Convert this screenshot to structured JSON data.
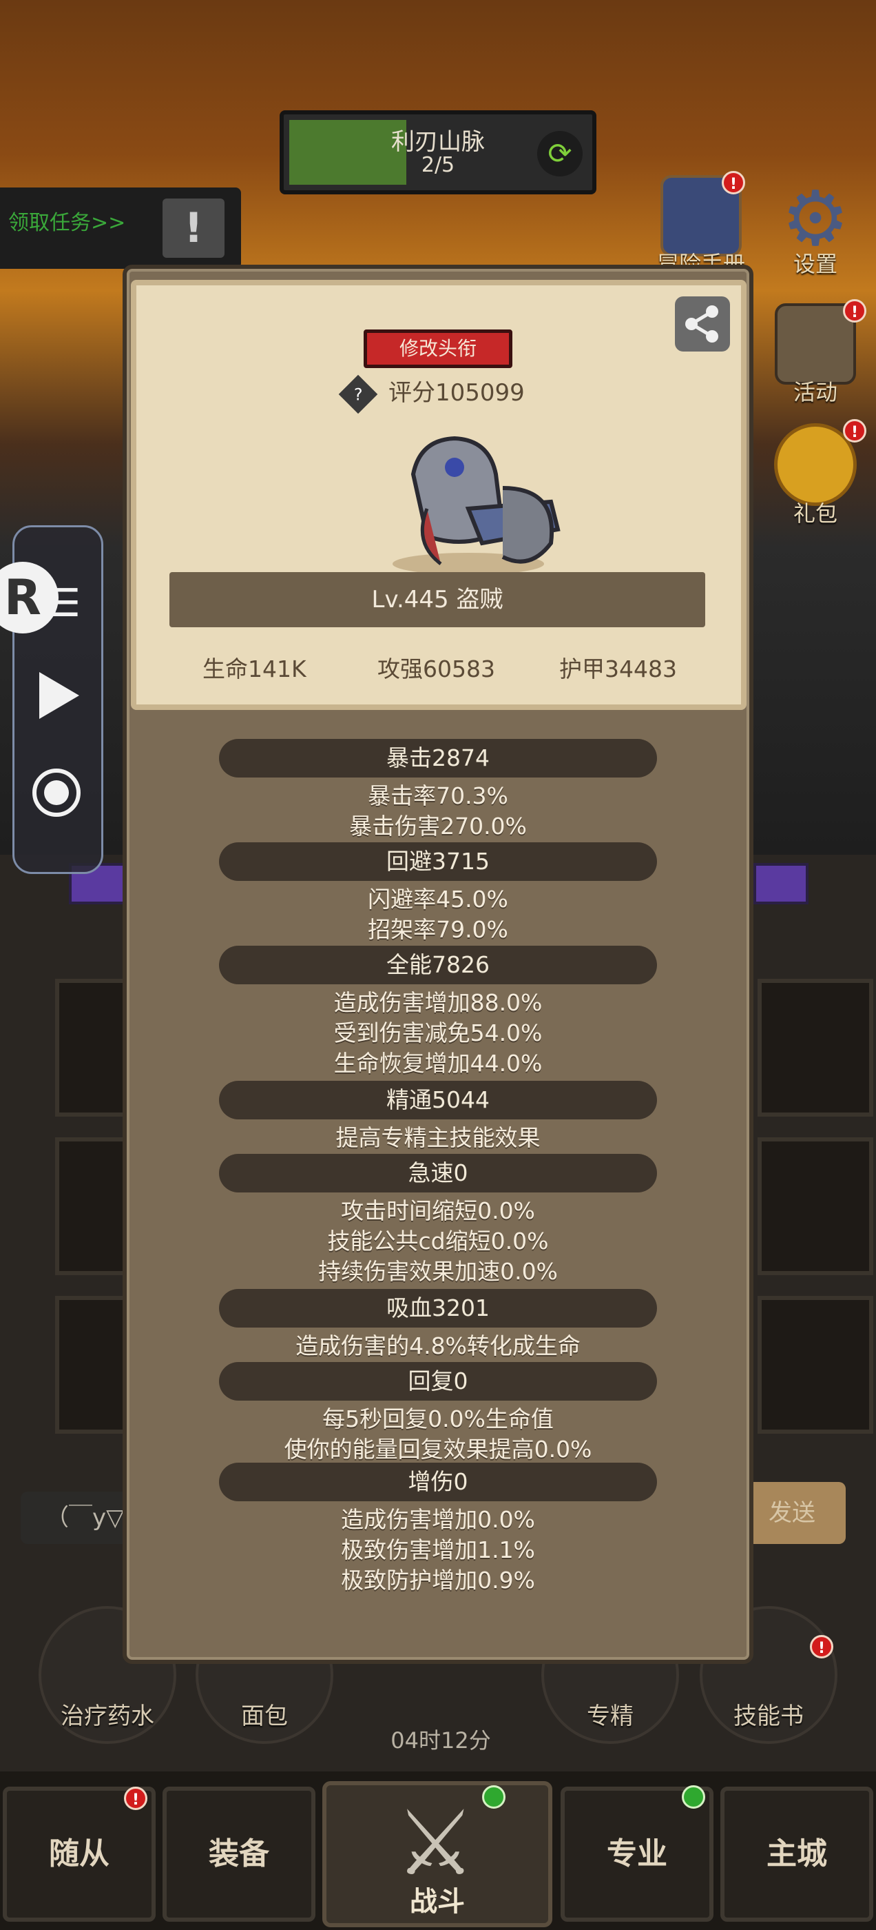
{
  "zone": {
    "name": "利刃山脉",
    "progress": "2/5",
    "progress_fraction": 0.35
  },
  "quest": {
    "label": "领取任务>>",
    "badge": "!"
  },
  "side_menu": [
    {
      "label": "冒险手册"
    },
    {
      "label": "设置"
    },
    {
      "label": "活动"
    },
    {
      "label": "礼包"
    }
  ],
  "badge_mark": "!",
  "chat": {
    "input_text": "（￣y▽",
    "send_label": "发送"
  },
  "consumables": [
    {
      "label": "治疗药水"
    },
    {
      "label": "面包"
    },
    {
      "label": "专精"
    },
    {
      "label": "技能书"
    }
  ],
  "timer": "04时12分",
  "nav": {
    "companion": "随从",
    "equipment": "装备",
    "battle": "战斗",
    "profession": "专业",
    "city": "主城"
  },
  "profile": {
    "change_title": "修改头衔",
    "score_icon": "?",
    "score": "评分105099",
    "level_class": "Lv.445 盗贼",
    "hp": "生命141K",
    "attack": "攻强60583",
    "armor": "护甲34483"
  },
  "sections": [
    {
      "header": "暴击2874",
      "lines": [
        "暴击率70.3%",
        "暴击伤害270.0%"
      ]
    },
    {
      "header": "回避3715",
      "lines": [
        "闪避率45.0%",
        "招架率79.0%"
      ]
    },
    {
      "header": "全能7826",
      "lines": [
        "造成伤害增加88.0%",
        "受到伤害减免54.0%",
        "生命恢复增加44.0%"
      ]
    },
    {
      "header": "精通5044",
      "lines": [
        "提高专精主技能效果"
      ]
    },
    {
      "header": "急速0",
      "lines": [
        "攻击时间缩短0.0%",
        "技能公共cd缩短0.0%",
        "持续伤害效果加速0.0%"
      ]
    },
    {
      "header": "吸血3201",
      "lines": [
        "造成伤害的4.8%转化成生命"
      ]
    },
    {
      "header": "回复0",
      "lines": [
        "每5秒回复0.0%生命值",
        "使你的能量回复效果提高0.0%"
      ]
    },
    {
      "header": "增伤0",
      "lines": [
        "造成伤害增加0.0%",
        "极致伤害增加1.1%",
        "极致防护增加0.9%"
      ]
    }
  ]
}
